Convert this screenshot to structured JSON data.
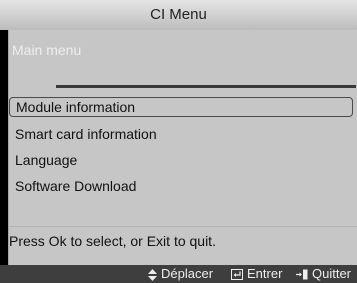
{
  "header": {
    "title": "CI Menu"
  },
  "menu": {
    "subtitle": "Main menu",
    "items": [
      {
        "label": "Module information",
        "selected": true
      },
      {
        "label": "Smart card information"
      },
      {
        "label": "Language"
      },
      {
        "label": "Software Download"
      }
    ],
    "help": "Press Ok to select, or Exit to quit."
  },
  "footer": {
    "move_icon": "up-down-arrows-icon",
    "move_label": "Déplacer",
    "enter_icon": "enter-icon",
    "enter_label": "Entrer",
    "quit_icon": "exit-icon",
    "quit_label": "Quitter"
  }
}
